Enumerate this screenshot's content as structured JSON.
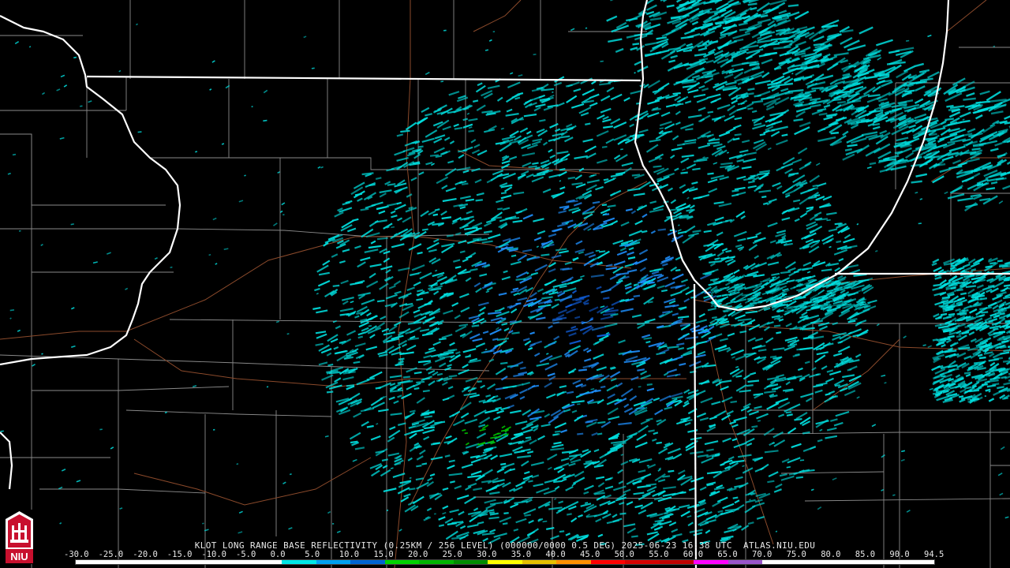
{
  "caption": {
    "station": "KLOT",
    "product": "LONG RANGE BASE REFLECTIVITY",
    "resolution": "(0.25KM / 256 LEVEL)",
    "vcp": "(000000/0000 0.5 DEG)",
    "datetime": "2025-06-23 16:38 UTC",
    "site": "ATLAS.NIU.EDU"
  },
  "colorbar": {
    "ticks": [
      "-30.0",
      "-25.0",
      "-20.0",
      "-15.0",
      "-10.0",
      "-5.0",
      "0.0",
      "5.0",
      "10.0",
      "15.0",
      "20.0",
      "25.0",
      "30.0",
      "35.0",
      "40.0",
      "45.0",
      "50.0",
      "55.0",
      "60.0",
      "65.0",
      "70.0",
      "75.0",
      "80.0",
      "85.0",
      "90.0",
      "94.5"
    ],
    "colors": [
      "#ffffff",
      "#ffffff",
      "#ffffff",
      "#ffffff",
      "#ffffff",
      "#ffffff",
      "#00e6e6",
      "#00a0f0",
      "#0064d2",
      "#00d200",
      "#00b400",
      "#008c00",
      "#ffff00",
      "#e6c000",
      "#ff9000",
      "#ff0000",
      "#d60000",
      "#c00000",
      "#ff00ff",
      "#9955c9",
      "#ffffff",
      "#ffffff",
      "#ffffff",
      "#ffffff",
      "#ffffff"
    ]
  },
  "logo": {
    "text": "NIU",
    "bg": "#c8102e"
  },
  "map": {
    "background": "#000000",
    "radar_center_lonlat": [
      -88.08,
      41.6
    ],
    "colors": {
      "state_border": "#ffffff",
      "county_border": "#8a8a8a",
      "highway": "#8b4a2b",
      "echo_light": "#00e0e0",
      "echo_mid": "#1e90ff",
      "echo_strong": "#1060e0",
      "echo_green": "#00c000"
    }
  }
}
